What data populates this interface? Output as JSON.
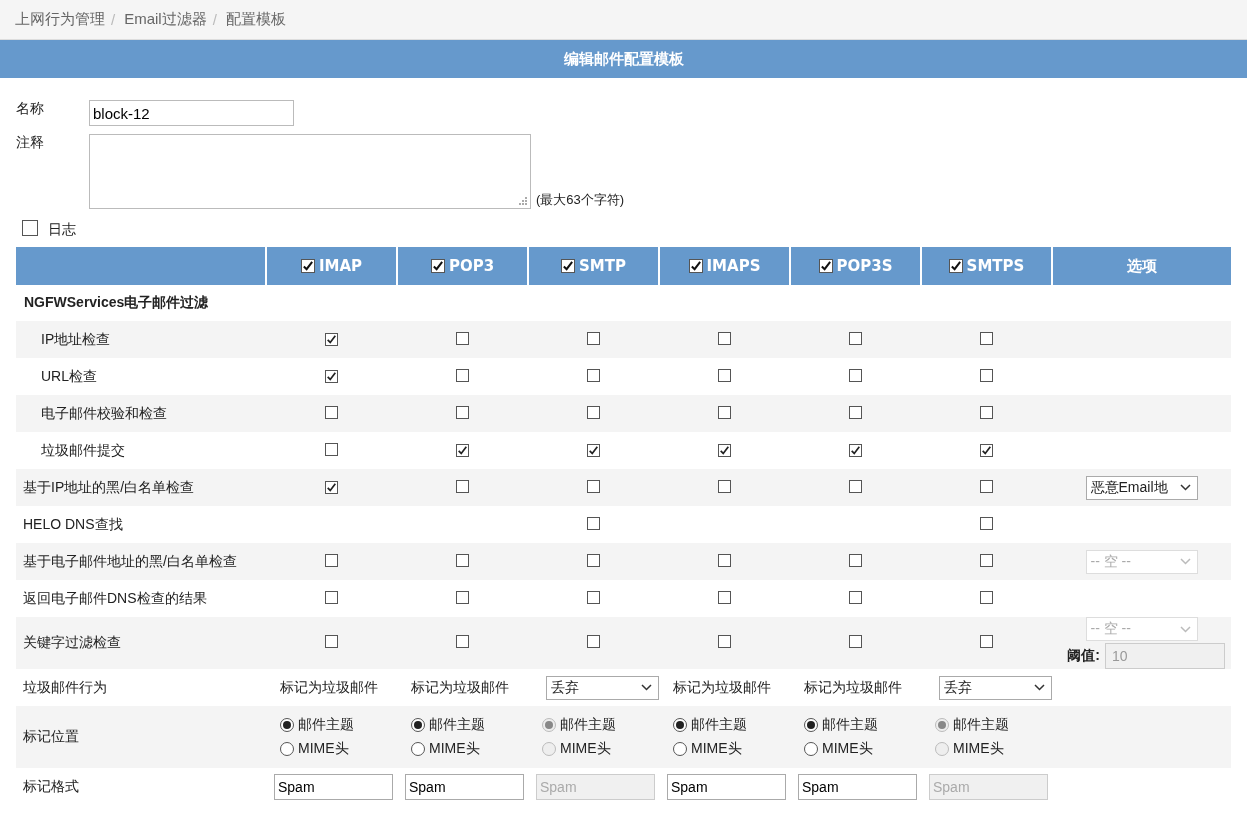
{
  "breadcrumb": {
    "items": [
      "上网行为管理",
      "Email过滤器",
      "配置模板"
    ],
    "separator": "/"
  },
  "title": "编辑邮件配置模板",
  "form": {
    "name_label": "名称",
    "name_value": "block-12",
    "comment_label": "注释",
    "comment_hint": "(最大63个字符)",
    "log": {
      "label": "日志",
      "checked": false
    }
  },
  "columns": {
    "protocols": [
      {
        "label": "IMAP",
        "checked": true
      },
      {
        "label": "POP3",
        "checked": true
      },
      {
        "label": "SMTP",
        "checked": true
      },
      {
        "label": "IMAPS",
        "checked": true
      },
      {
        "label": "POP3S",
        "checked": true
      },
      {
        "label": "SMTPS",
        "checked": true
      }
    ],
    "options_label": "选项"
  },
  "rows": [
    {
      "kind": "group",
      "label": "NGFWServices电子邮件过滤",
      "children": [
        {
          "label": "IP地址检查",
          "checks": [
            {
              "checked": true
            },
            {
              "checked": false
            },
            {
              "checked": false
            },
            {
              "checked": false
            },
            {
              "checked": false
            },
            {
              "checked": false
            }
          ]
        },
        {
          "label": "URL检查",
          "checks": [
            {
              "checked": true
            },
            {
              "checked": false
            },
            {
              "checked": false
            },
            {
              "checked": false
            },
            {
              "checked": false
            },
            {
              "checked": false
            }
          ]
        },
        {
          "label": "电子邮件校验和检查",
          "checks": [
            {
              "checked": false
            },
            {
              "checked": false
            },
            {
              "checked": false
            },
            {
              "checked": false
            },
            {
              "checked": false
            },
            {
              "checked": false
            }
          ]
        },
        {
          "label": "垃圾邮件提交",
          "checks": [
            {
              "checked": false
            },
            {
              "checked": true
            },
            {
              "checked": true
            },
            {
              "checked": true
            },
            {
              "checked": true
            },
            {
              "checked": true
            }
          ]
        }
      ]
    },
    {
      "kind": "check",
      "label": "基于IP地址的黑/白名单检查",
      "checks": [
        {
          "checked": true
        },
        {
          "checked": false
        },
        {
          "checked": false
        },
        {
          "checked": false
        },
        {
          "checked": false
        },
        {
          "checked": false
        }
      ],
      "option": {
        "value": "恶意Email地",
        "disabled": false
      }
    },
    {
      "kind": "check",
      "label": "HELO DNS查找",
      "checks": [
        {
          "kind": "none"
        },
        {
          "kind": "none"
        },
        {
          "kind": "box",
          "checked": false
        },
        {
          "kind": "none"
        },
        {
          "kind": "none"
        },
        {
          "kind": "box",
          "checked": false
        }
      ]
    },
    {
      "kind": "check",
      "label": "基于电子邮件地址的黑/白名单检查",
      "checks": [
        {
          "checked": false
        },
        {
          "checked": false
        },
        {
          "checked": false
        },
        {
          "checked": false
        },
        {
          "checked": false
        },
        {
          "checked": false
        }
      ],
      "option": {
        "value": "-- 空 --",
        "disabled": true
      }
    },
    {
      "kind": "check",
      "label": "返回电子邮件DNS检查的结果",
      "checks": [
        {
          "checked": false
        },
        {
          "checked": false
        },
        {
          "checked": false
        },
        {
          "checked": false
        },
        {
          "checked": false
        },
        {
          "checked": false
        }
      ]
    },
    {
      "kind": "check",
      "label": "关键字过滤检查",
      "checks": [
        {
          "checked": false
        },
        {
          "checked": false
        },
        {
          "checked": false
        },
        {
          "checked": false
        },
        {
          "checked": false
        },
        {
          "checked": false
        }
      ],
      "option": {
        "value": "-- 空 --",
        "disabled": true,
        "threshold": {
          "label": "阈值:",
          "value": "10",
          "disabled": true
        }
      }
    },
    {
      "kind": "action",
      "label": "垃圾邮件行为",
      "cells": [
        {
          "kind": "text",
          "text": "标记为垃圾邮件"
        },
        {
          "kind": "text",
          "text": "标记为垃圾邮件"
        },
        {
          "kind": "select",
          "value": "丢弃"
        },
        {
          "kind": "text",
          "text": "标记为垃圾邮件"
        },
        {
          "kind": "text",
          "text": "标记为垃圾邮件"
        },
        {
          "kind": "select",
          "value": "丢弃"
        }
      ]
    },
    {
      "kind": "position",
      "label": "标记位置",
      "cells": [
        {
          "disabled": false,
          "options": [
            {
              "label": "邮件主题",
              "selected": true
            },
            {
              "label": "MIME头",
              "selected": false
            }
          ]
        },
        {
          "disabled": false,
          "options": [
            {
              "label": "邮件主题",
              "selected": true
            },
            {
              "label": "MIME头",
              "selected": false
            }
          ]
        },
        {
          "disabled": true,
          "options": [
            {
              "label": "邮件主题",
              "selected": true
            },
            {
              "label": "MIME头",
              "selected": false
            }
          ]
        },
        {
          "disabled": false,
          "options": [
            {
              "label": "邮件主题",
              "selected": true
            },
            {
              "label": "MIME头",
              "selected": false
            }
          ]
        },
        {
          "disabled": false,
          "options": [
            {
              "label": "邮件主题",
              "selected": true
            },
            {
              "label": "MIME头",
              "selected": false
            }
          ]
        },
        {
          "disabled": true,
          "options": [
            {
              "label": "邮件主题",
              "selected": true
            },
            {
              "label": "MIME头",
              "selected": false
            }
          ]
        }
      ]
    },
    {
      "kind": "format",
      "label": "标记格式",
      "cells": [
        {
          "value": "Spam",
          "disabled": false
        },
        {
          "value": "Spam",
          "disabled": false
        },
        {
          "value": "Spam",
          "disabled": true
        },
        {
          "value": "Spam",
          "disabled": false
        },
        {
          "value": "Spam",
          "disabled": false
        },
        {
          "value": "Spam",
          "disabled": true
        }
      ]
    }
  ]
}
